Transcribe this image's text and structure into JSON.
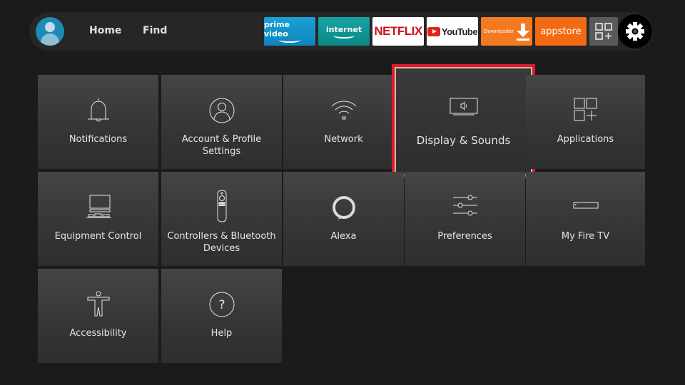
{
  "topbar": {
    "profile_icon": "user-avatar-icon",
    "nav": [
      {
        "label": "Home"
      },
      {
        "label": "Find"
      }
    ],
    "apps": [
      {
        "name": "prime-video",
        "label": "prime video",
        "color": "#1aa1d6"
      },
      {
        "name": "internet",
        "label": "internet",
        "color": "#16a3a3"
      },
      {
        "name": "netflix",
        "label": "NETFLIX",
        "color": "#d0121b"
      },
      {
        "name": "youtube",
        "label": "YouTube",
        "color": "#e62117"
      },
      {
        "name": "downloader",
        "label": "Downloader",
        "color": "#f47a22"
      },
      {
        "name": "appstore",
        "label": "appstore",
        "color": "#f26a14"
      }
    ],
    "more_apps_icon": "apps-grid-plus-icon",
    "settings_icon": "gear-icon"
  },
  "settings": {
    "focused_item": "Display & Sounds",
    "focus_color": "#e0182a",
    "tiles": [
      {
        "label": "Notifications",
        "icon": "bell-icon"
      },
      {
        "label": "Account & Profile Settings",
        "icon": "user-circle-icon"
      },
      {
        "label": "Network",
        "icon": "wifi-icon"
      },
      {
        "label": "Display & Sounds",
        "icon": "tv-speaker-icon"
      },
      {
        "label": "Applications",
        "icon": "apps-grid-icon"
      },
      {
        "label": "Equipment Control",
        "icon": "tv-equipment-icon"
      },
      {
        "label": "Controllers & Bluetooth Devices",
        "icon": "remote-icon"
      },
      {
        "label": "Alexa",
        "icon": "alexa-ring-icon"
      },
      {
        "label": "Preferences",
        "icon": "sliders-icon"
      },
      {
        "label": "My Fire TV",
        "icon": "fire-tv-stick-icon"
      },
      {
        "label": "Accessibility",
        "icon": "accessibility-icon"
      },
      {
        "label": "Help",
        "icon": "help-circle-icon"
      }
    ]
  }
}
